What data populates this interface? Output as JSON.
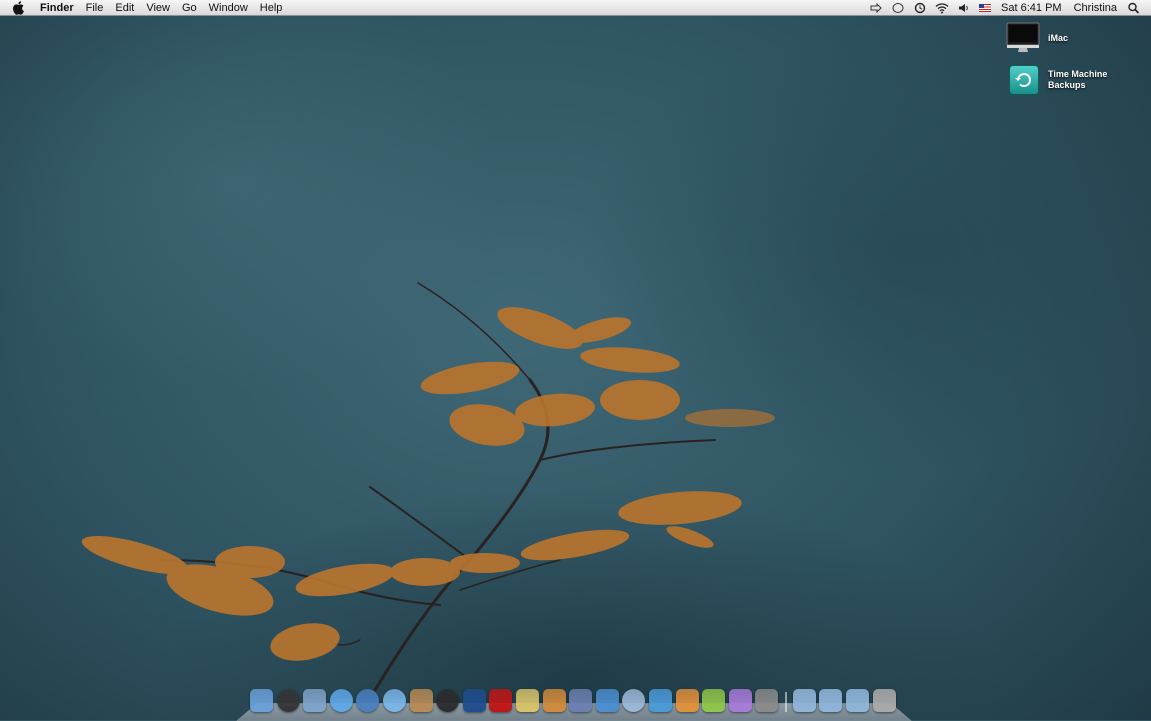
{
  "menubar": {
    "app_name": "Finder",
    "menus": [
      "File",
      "Edit",
      "View",
      "Go",
      "Window",
      "Help"
    ],
    "clock": "Sat 6:41 PM",
    "user": "Christina"
  },
  "desktop_icons": [
    {
      "label": "iMac",
      "icon": "imac-icon"
    },
    {
      "label": "Time Machine Backups",
      "icon": "time-machine-icon"
    }
  ],
  "dock": {
    "apps": [
      {
        "name": "finder",
        "color": "#6aa0d8"
      },
      {
        "name": "dashboard",
        "color": "#333333"
      },
      {
        "name": "preview",
        "color": "#7fa3c9"
      },
      {
        "name": "ichat",
        "color": "#5fa8e8"
      },
      {
        "name": "safari",
        "color": "#4a7fc0"
      },
      {
        "name": "itunes",
        "color": "#7ab6e8"
      },
      {
        "name": "iphoto",
        "color": "#b88a55"
      },
      {
        "name": "aperture",
        "color": "#2a2a2a"
      },
      {
        "name": "photoshop",
        "color": "#1e4d8c"
      },
      {
        "name": "flash",
        "color": "#c01515"
      },
      {
        "name": "imovie",
        "color": "#d8c36a"
      },
      {
        "name": "keynote",
        "color": "#d08a3a"
      },
      {
        "name": "xcode",
        "color": "#6c7fb0"
      },
      {
        "name": "numbers",
        "color": "#4a8fd0"
      },
      {
        "name": "mail",
        "color": "#9ab8d8"
      },
      {
        "name": "iweb",
        "color": "#4a9ad8"
      },
      {
        "name": "pages",
        "color": "#e0903a"
      },
      {
        "name": "garageband",
        "color": "#8fc64a"
      },
      {
        "name": "skype",
        "color": "#a87ad8"
      },
      {
        "name": "system-preferences",
        "color": "#8a8a8a"
      }
    ],
    "folders": [
      {
        "name": "applications-folder",
        "color": "#8fb4d8"
      },
      {
        "name": "documents-folder",
        "color": "#8fb4d8"
      },
      {
        "name": "downloads-folder",
        "color": "#8fb4d8"
      },
      {
        "name": "trash",
        "color": "#a8a8a8"
      }
    ]
  }
}
